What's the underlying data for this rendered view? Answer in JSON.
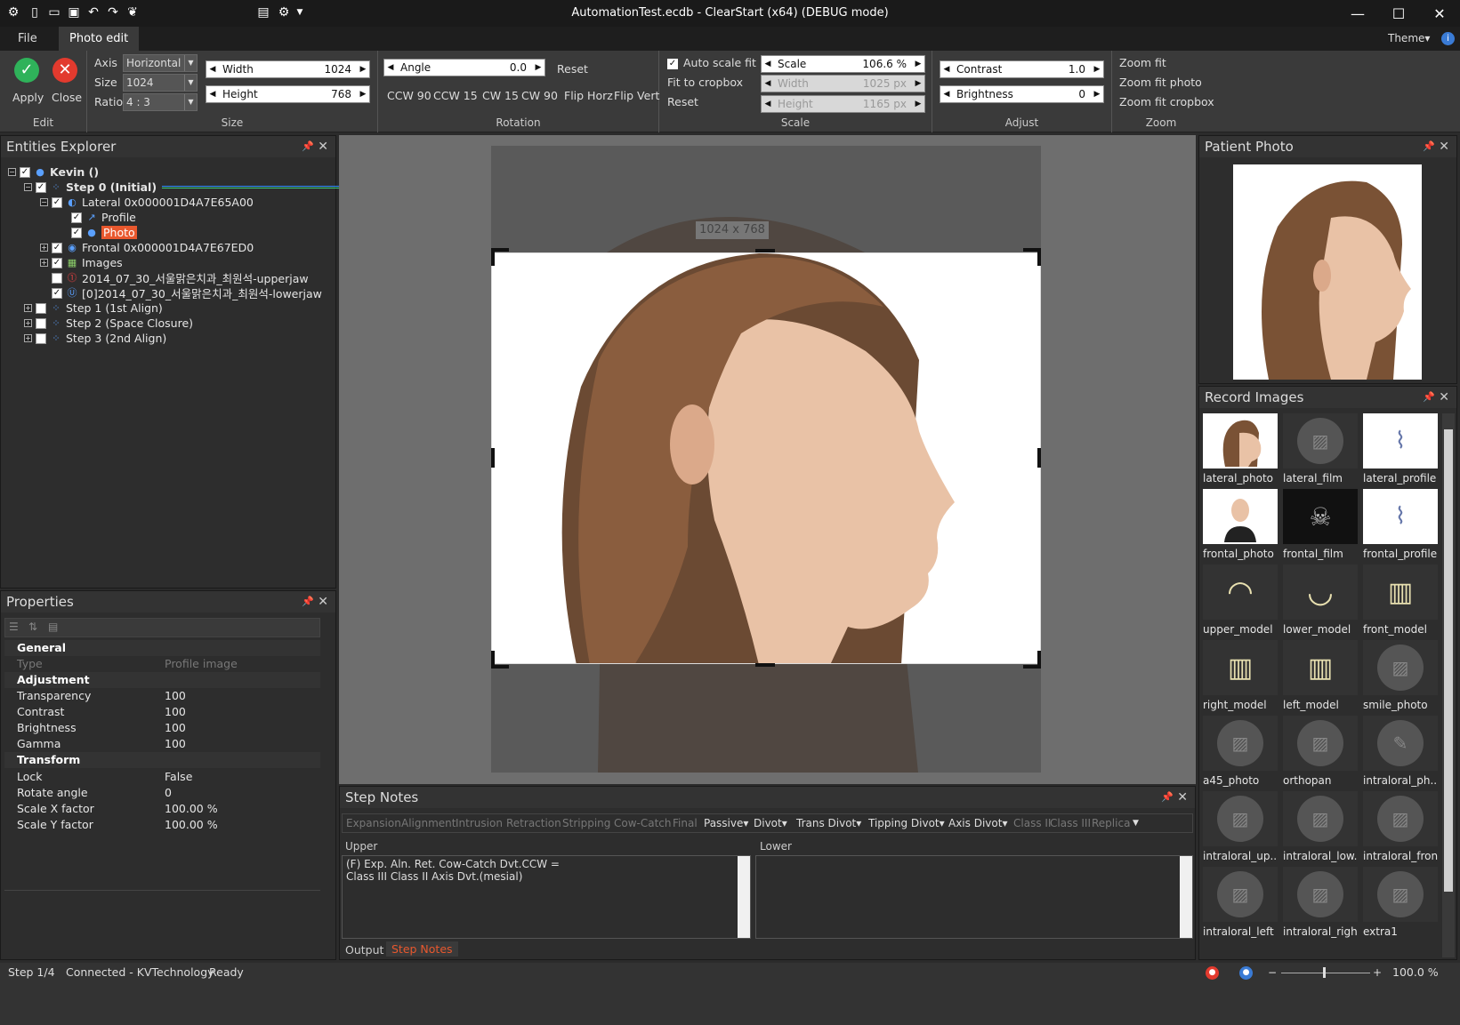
{
  "window": {
    "title": "AutomationTest.ecdb - ClearStart (x64) (DEBUG mode)",
    "theme": "Theme"
  },
  "menu": {
    "file": "File",
    "photo_edit": "Photo edit"
  },
  "ribbon": {
    "edit": {
      "apply": "Apply",
      "close": "Close",
      "group": "Edit"
    },
    "size": {
      "axis_label": "Axis",
      "axis_value": "Horizontal",
      "size_label": "Size",
      "size_value": "1024",
      "ratio_label": "Ratio",
      "ratio_value": "4 : 3",
      "width_label": "Width",
      "width_value": "1024",
      "height_label": "Height",
      "height_value": "768",
      "group": "Size"
    },
    "rotation": {
      "angle_label": "Angle",
      "angle_value": "0.0",
      "reset": "Reset",
      "ccw90": "CCW 90",
      "ccw15": "CCW 15",
      "cw15": "CW 15",
      "cw90": "CW 90",
      "flip_horz": "Flip Horz",
      "flip_vert": "Flip Vert",
      "group": "Rotation"
    },
    "scale": {
      "auto_scale_fit": "Auto scale fit",
      "fit_to_cropbox": "Fit to cropbox",
      "reset": "Reset",
      "scale_label": "Scale",
      "scale_value": "106.6 %",
      "width_label": "Width",
      "width_value": "1025 px",
      "height_label": "Height",
      "height_value": "1165 px",
      "group": "Scale"
    },
    "adjust": {
      "contrast_label": "Contrast",
      "contrast_value": "1.0",
      "brightness_label": "Brightness",
      "brightness_value": "0",
      "group": "Adjust"
    },
    "zoom": {
      "zoom_fit": "Zoom fit",
      "zoom_fit_photo": "Zoom fit photo",
      "zoom_fit_cropbox": "Zoom fit cropbox",
      "group": "Zoom"
    }
  },
  "entities": {
    "title": "Entities Explorer",
    "items": [
      {
        "label": "Kevin ()",
        "bold": true
      },
      {
        "label": "Step 0 (Initial)",
        "bold": true
      },
      {
        "label": "Lateral 0x000001D4A7E65A00"
      },
      {
        "label": "Profile"
      },
      {
        "label": "Photo"
      },
      {
        "label": "Frontal 0x000001D4A7E67ED0"
      },
      {
        "label": "Images"
      },
      {
        "label": "2014_07_30_서울맑은치과_최원석-upperjaw"
      },
      {
        "label": "[0]2014_07_30_서울맑은치과_최원석-lowerjaw"
      },
      {
        "label": "Step 1 (1st Align)"
      },
      {
        "label": "Step 2 (Space Closure)"
      },
      {
        "label": "Step 3 (2nd Align)"
      }
    ]
  },
  "properties": {
    "title": "Properties",
    "general": "General",
    "type_k": "Type",
    "type_v": "Profile image",
    "adjustment": "Adjustment",
    "rows_adj": [
      {
        "k": "Transparency",
        "v": "100"
      },
      {
        "k": "Contrast",
        "v": "100"
      },
      {
        "k": "Brightness",
        "v": "100"
      },
      {
        "k": "Gamma",
        "v": "100"
      }
    ],
    "transform": "Transform",
    "rows_tr": [
      {
        "k": "Lock",
        "v": "False"
      },
      {
        "k": "Rotate angle",
        "v": "0"
      },
      {
        "k": "Scale X factor",
        "v": "100.00 %"
      },
      {
        "k": "Scale Y factor",
        "v": "100.00 %"
      }
    ]
  },
  "canvas": {
    "crop_label": "1024 x 768"
  },
  "patient_photo": {
    "title": "Patient Photo"
  },
  "record_images": {
    "title": "Record Images",
    "items": [
      "lateral_photo",
      "lateral_film",
      "lateral_profile",
      "frontal_photo",
      "frontal_film",
      "frontal_profile",
      "upper_model",
      "lower_model",
      "front_model",
      "right_model",
      "left_model",
      "smile_photo",
      "a45_photo",
      "orthopan",
      "intraloral_ph...",
      "intraloral_up...",
      "intraloral_low...",
      "intraloral_front",
      "intraloral_left",
      "intraloral_right",
      "extra1"
    ]
  },
  "step_notes": {
    "title": "Step Notes",
    "tabs": [
      "Expansion",
      "Alignment",
      "Intrusion",
      "Retraction",
      "Stripping",
      "Cow-Catch",
      "Final"
    ],
    "dropdowns": [
      "Passive",
      "Divot",
      "Trans Divot",
      "Tipping Divot",
      "Axis Divot"
    ],
    "tabs_after": [
      "Class II",
      "Class III",
      "Replica"
    ],
    "upper_label": "Upper",
    "lower_label": "Lower",
    "upper_text": "(F) Exp. Aln. Ret. Cow-Catch Dvt.CCW =\nClass III Class II Axis Dvt.(mesial)",
    "bottom_tabs": [
      "Output",
      "Step Notes"
    ]
  },
  "status": {
    "step": "Step 1/4",
    "connection": "Connected - KVTechnology",
    "state": "Ready",
    "zoom": "100.0 %"
  }
}
